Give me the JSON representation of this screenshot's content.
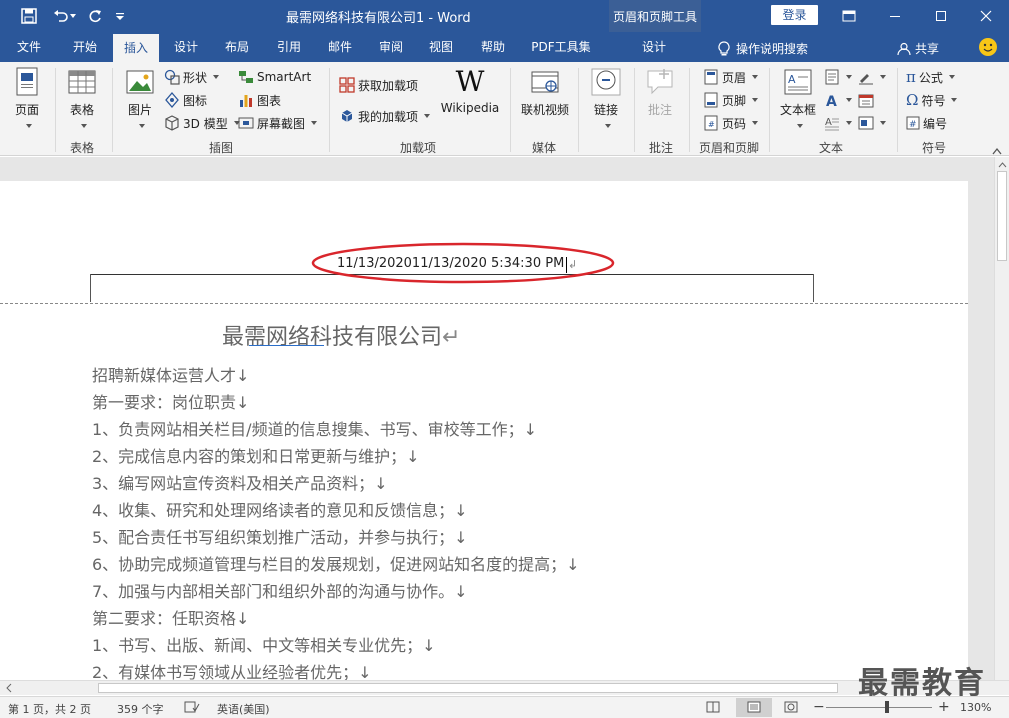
{
  "window": {
    "title": "最需网络科技有限公司1  -  Word",
    "context_tab_title": "页眉和页脚工具",
    "login_label": "登录"
  },
  "tabs": [
    {
      "label": "文件"
    },
    {
      "label": "开始"
    },
    {
      "label": "插入"
    },
    {
      "label": "设计"
    },
    {
      "label": "布局"
    },
    {
      "label": "引用"
    },
    {
      "label": "邮件"
    },
    {
      "label": "审阅"
    },
    {
      "label": "视图"
    },
    {
      "label": "帮助"
    },
    {
      "label": "PDF工具集"
    },
    {
      "label": "设计"
    }
  ],
  "tell_me": "操作说明搜索",
  "share_label": "共享",
  "ribbon": {
    "pages": {
      "button": "页面",
      "group": ""
    },
    "tables": {
      "button": "表格",
      "group": "表格"
    },
    "illustrations": {
      "group": "插图",
      "picture": "图片",
      "shapes": "形状",
      "icons": "图标",
      "model3d": "3D 模型",
      "smartart": "SmartArt",
      "chart": "图表",
      "screenshot": "屏幕截图"
    },
    "addins": {
      "group": "加载项",
      "get": "获取加载项",
      "my": "我的加载项",
      "wikipedia": "Wikipedia"
    },
    "media": {
      "group": "媒体",
      "online_video": "联机视频"
    },
    "links": {
      "button": "链接"
    },
    "comments": {
      "group": "批注",
      "button": "批注"
    },
    "header_footer": {
      "group": "页眉和页脚",
      "header": "页眉",
      "footer": "页脚",
      "page_number": "页码"
    },
    "text": {
      "group": "文本",
      "textbox": "文本框"
    },
    "symbols": {
      "group": "符号",
      "equation": "公式",
      "symbol": "符号",
      "number": "编号"
    }
  },
  "document": {
    "header_text": "11/13/202011/13/2020 5:34:30 PM",
    "title": "最需网络科技有限公司",
    "lines": [
      "招聘新媒体运营人才↓",
      "第一要求：岗位职责↓",
      "1、负责网站相关栏目/频道的信息搜集、书写、审校等工作；↓",
      "2、完成信息内容的策划和日常更新与维护；↓",
      "3、编写网站宣传资料及相关产品资料；↓",
      "4、收集、研究和处理网络读者的意见和反馈信息；↓",
      "5、配合责任书写组织策划推广活动，并参与执行；↓",
      "6、协助完成频道管理与栏目的发展规划，促进网站知名度的提高；↓",
      "7、加强与内部相关部门和组织外部的沟通与协作。↓",
      "第二要求：任职资格↓",
      "1、书写、出版、新闻、中文等相关专业优先；↓",
      "2、有媒体书写领域从业经验者优先；↓"
    ]
  },
  "status": {
    "page": "第 1 页，共 2 页",
    "words": "359 个字",
    "language": "英语(美国)",
    "zoom": "130%"
  },
  "watermark": "最需教育",
  "colors": {
    "accent": "#2b579a",
    "annotation": "#d9262c"
  }
}
